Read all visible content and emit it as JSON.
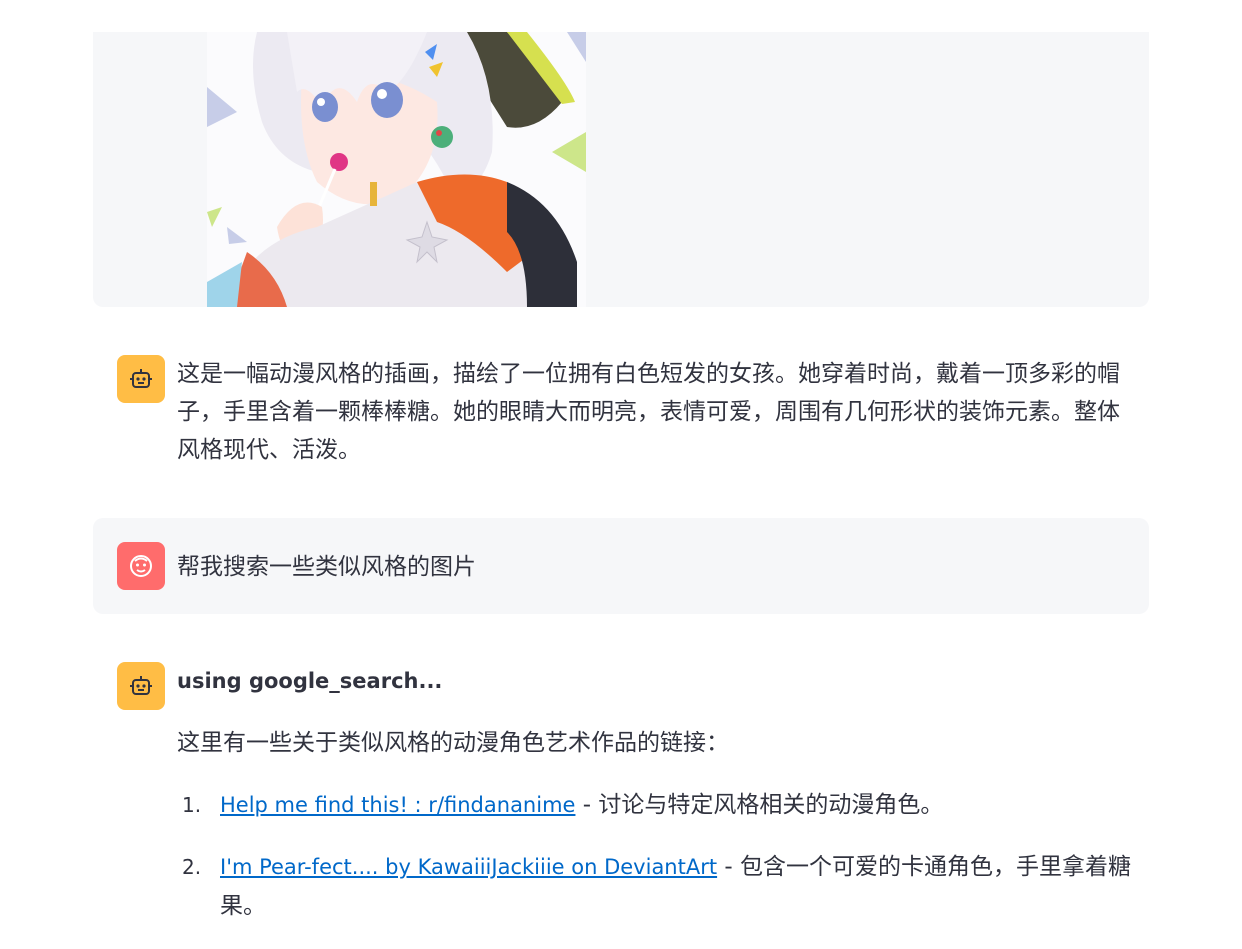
{
  "conversation": {
    "bot_description": "这是一幅动漫风格的插画，描绘了一位拥有白色短发的女孩。她穿着时尚，戴着一顶多彩的帽子，手里含着一颗棒棒糖。她的眼睛大而明亮，表情可爱，周围有几何形状的装饰元素。整体风格现代、活泼。",
    "user_request": "帮我搜索一些类似风格的图片",
    "tool_status": "using google_search...",
    "intro": "这里有一些关于类似风格的动漫角色艺术作品的链接：",
    "results": [
      {
        "num": "1.",
        "link": "Help me find this! : r/findananime",
        "desc": " - 讨论与特定风格相关的动漫角色。"
      },
      {
        "num": "2.",
        "link": "I'm Pear-fect.... by KawaiiiJackiiie on DeviantArt",
        "desc": " - 包含一个可爱的卡通角色，手里拿着糖果。"
      }
    ]
  },
  "colors": {
    "bot_avatar": "#ffbd45",
    "user_avatar": "#ff6c6c",
    "link": "#0068c9",
    "message_bg": "#f6f7f9"
  },
  "icons": {
    "bot": "robot-face-icon",
    "user": "smiley-face-icon"
  }
}
